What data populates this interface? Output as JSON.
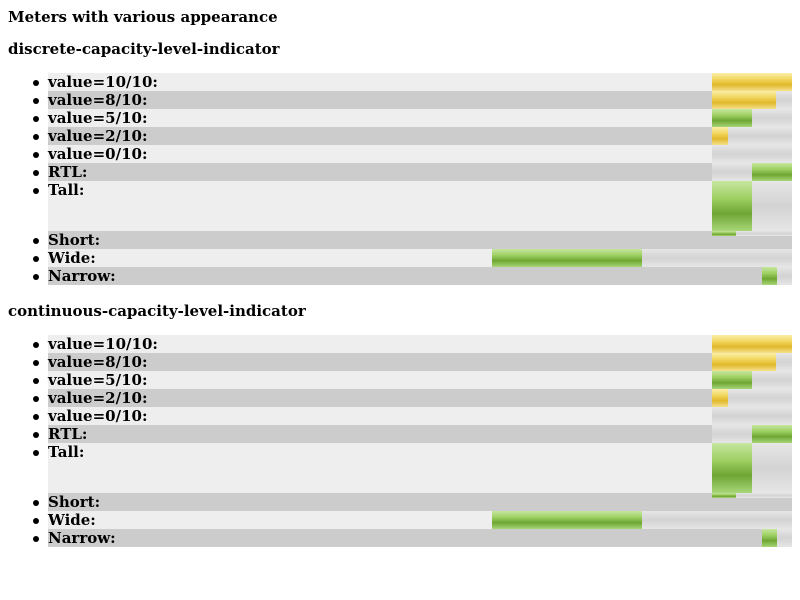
{
  "page_title": "Meters with various appearance",
  "sections": [
    {
      "title": "discrete-capacity-level-indicator",
      "items": [
        {
          "label": "value=10/10:",
          "value": 10,
          "max": 10,
          "color": "#e8c43a"
        },
        {
          "label": "value=8/10:",
          "value": 8,
          "max": 10,
          "color": "#e8c43a"
        },
        {
          "label": "value=5/10:",
          "value": 5,
          "max": 10,
          "color": "#7cb342"
        },
        {
          "label": "value=2/10:",
          "value": 2,
          "max": 10,
          "color": "#e8c43a"
        },
        {
          "label": "value=0/10:",
          "value": 0,
          "max": 10,
          "color": "#7cb342"
        },
        {
          "label": "RTL:",
          "value": 5,
          "max": 10,
          "color": "#7cb342",
          "dir": "rtl"
        },
        {
          "label": "Tall:",
          "value": 5,
          "max": 10,
          "color": "#7cb342"
        },
        {
          "label": "Short:",
          "value": 3,
          "max": 10,
          "color": "#7cb342"
        },
        {
          "label": "Wide:",
          "value": 5,
          "max": 10,
          "color": "#7cb342"
        },
        {
          "label": "Narrow:",
          "value": 5,
          "max": 10,
          "color": "#7cb342"
        }
      ]
    },
    {
      "title": "continuous-capacity-level-indicator",
      "items": [
        {
          "label": "value=10/10:",
          "value": 10,
          "max": 10,
          "color": "#e8c43a"
        },
        {
          "label": "value=8/10:",
          "value": 8,
          "max": 10,
          "color": "#e8c43a"
        },
        {
          "label": "value=5/10:",
          "value": 5,
          "max": 10,
          "color": "#7cb342"
        },
        {
          "label": "value=2/10:",
          "value": 2,
          "max": 10,
          "color": "#e8c43a"
        },
        {
          "label": "value=0/10:",
          "value": 0,
          "max": 10,
          "color": "#7cb342"
        },
        {
          "label": "RTL:",
          "value": 5,
          "max": 10,
          "color": "#7cb342",
          "dir": "rtl"
        },
        {
          "label": "Tall:",
          "value": 5,
          "max": 10,
          "color": "#7cb342"
        },
        {
          "label": "Short:",
          "value": 3,
          "max": 10,
          "color": "#7cb342"
        },
        {
          "label": "Wide:",
          "value": 5,
          "max": 10,
          "color": "#7cb342"
        },
        {
          "label": "Narrow:",
          "value": 5,
          "max": 10,
          "color": "#7cb342"
        }
      ]
    }
  ]
}
